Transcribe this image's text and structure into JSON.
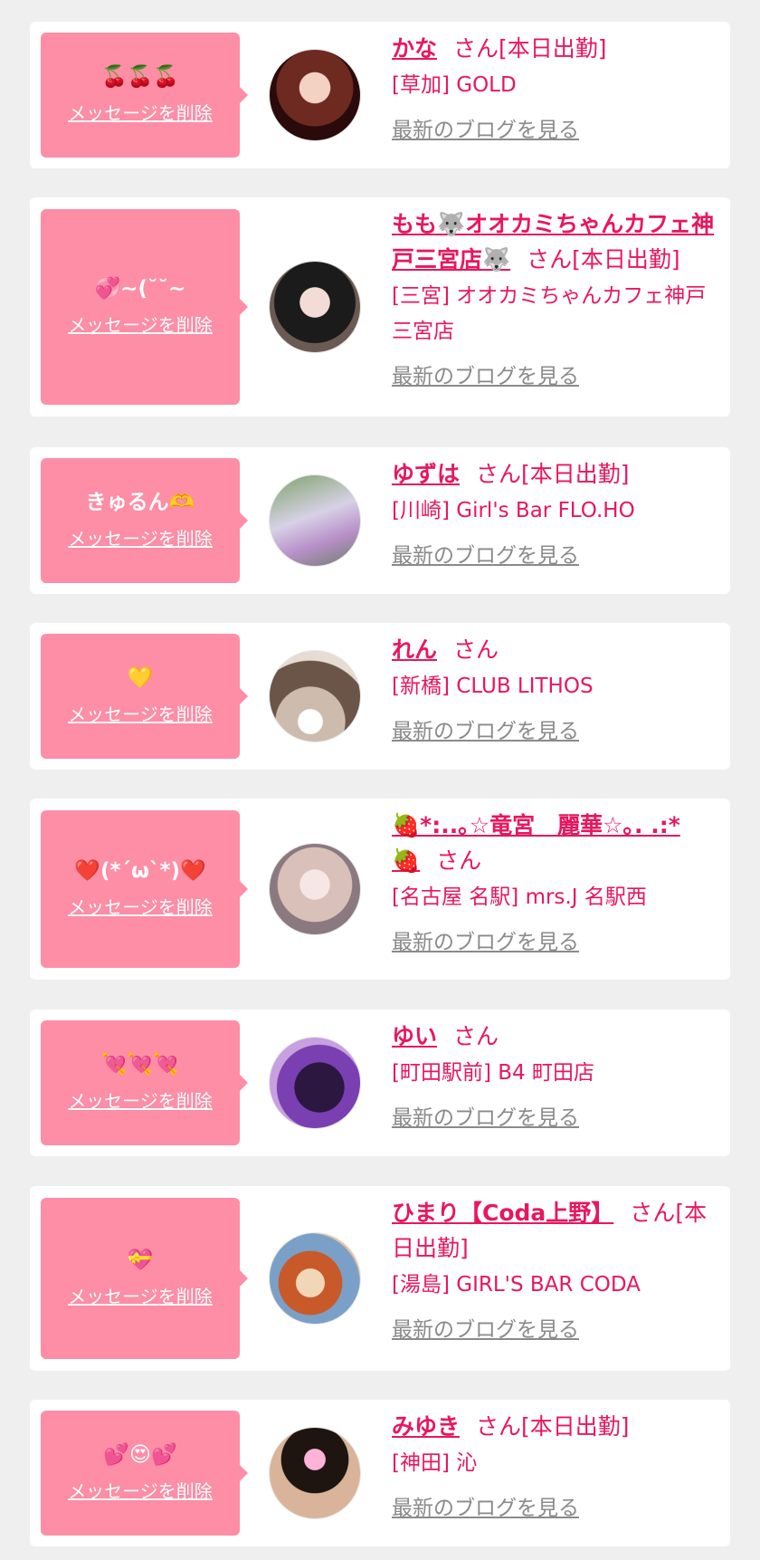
{
  "delete_label": "メッセージを削除",
  "blog_label": "最新のブログを見る",
  "suffix": "さん",
  "colors": {
    "background": "#efefef",
    "card": "#ffffff",
    "bubble": "#fe8da6",
    "accent": "#e8175d",
    "link_gray": "#8a8a8a"
  },
  "cards": [
    {
      "message": "🍒🍒🍒",
      "name": "かな",
      "status": "[本日出勤]",
      "shop": "[草加] GOLD"
    },
    {
      "message": "💞~(˘˘~",
      "name": "もも🐺オオカミちゃんカフェ神戸三宮店🐺",
      "status": "[本日出勤]",
      "shop": "[三宮] オオカミちゃんカフェ神戸三宮店"
    },
    {
      "message": "きゅるん🫶",
      "name": "ゆずは",
      "status": "[本日出勤]",
      "shop": "[川崎] Girl's Bar FLO.HO"
    },
    {
      "message": "💛",
      "name": "れん",
      "status": "",
      "shop": "[新橋] CLUB LITHOS"
    },
    {
      "message": "❤️(*´ω`*)❤️",
      "name": "🍓*:..｡☆竜宮　麗華☆｡. .:*🍓",
      "status": "",
      "shop": "[名古屋 名駅] mrs.J 名駅西"
    },
    {
      "message": "💘💘💘",
      "name": "ゆい",
      "status": "",
      "shop": "[町田駅前] B4 町田店"
    },
    {
      "message": "💝",
      "name": "ひまり【Coda上野】",
      "status": "[本日出勤]",
      "shop": "[湯島] GIRL'S BAR CODA"
    },
    {
      "message": "💕😍💕",
      "name": "みゆき",
      "status": "[本日出勤]",
      "shop": "[神田] 沁"
    }
  ]
}
